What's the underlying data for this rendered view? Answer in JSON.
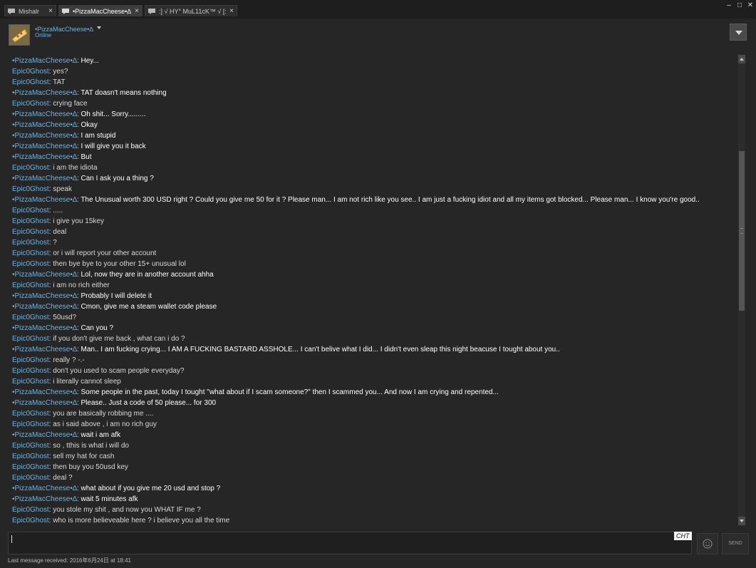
{
  "tabs": [
    {
      "label": "Mishalr",
      "close": "×"
    },
    {
      "label": "•PizzaMacCheese•∆",
      "close": "×"
    },
    {
      "label": ":] √ HY° MuL11cK™ √ [:",
      "close": "×"
    }
  ],
  "window_controls": {
    "minimize": "–",
    "maximize": "□",
    "close": "✕"
  },
  "header": {
    "name": "•PizzaMacCheese•∆",
    "status": "Online"
  },
  "messages": [
    {
      "who": "•PizzaMacCheese•∆",
      "text": "Hey...",
      "them": true
    },
    {
      "who": "Epic0Ghost",
      "text": "yes?",
      "them": false
    },
    {
      "who": "Epic0Ghost",
      "text": "TAT",
      "them": false
    },
    {
      "who": "•PizzaMacCheese•∆",
      "text": "TAT doasn't means nothing",
      "them": true
    },
    {
      "who": "Epic0Ghost",
      "text": "crying face",
      "them": false
    },
    {
      "who": "•PizzaMacCheese•∆",
      "text": "Oh shit... Sorry.........",
      "them": true
    },
    {
      "who": "•PizzaMacCheese•∆",
      "text": "Okay",
      "them": true
    },
    {
      "who": "•PizzaMacCheese•∆",
      "text": "I am stupid",
      "them": true
    },
    {
      "who": "•PizzaMacCheese•∆",
      "text": "I will give you it back",
      "them": true
    },
    {
      "who": "•PizzaMacCheese•∆",
      "text": "But",
      "them": true
    },
    {
      "who": "Epic0Ghost",
      "text": "i am the idiota",
      "them": false
    },
    {
      "who": "•PizzaMacCheese•∆",
      "text": "Can I ask you a thing ?",
      "them": true
    },
    {
      "who": "Epic0Ghost",
      "text": "speak",
      "them": false
    },
    {
      "who": "•PizzaMacCheese•∆",
      "text": "The Unusual worth 300 USD right ? Could you give me 50 for it ? Please man... I am not rich like you see.. I am just a fucking idiot and all my items got blocked... Please man... I know you're good..",
      "them": true
    },
    {
      "who": "Epic0Ghost",
      "text": ".....",
      "them": false
    },
    {
      "who": "Epic0Ghost",
      "text": "i give you 15key",
      "them": false
    },
    {
      "who": "Epic0Ghost",
      "text": "deal",
      "them": false
    },
    {
      "who": "Epic0Ghost",
      "text": "?",
      "them": false
    },
    {
      "who": "Epic0Ghost",
      "text": "or i will report your other account",
      "them": false
    },
    {
      "who": "Epic0Ghost",
      "text": "then bye bye to your other 15+ unusual lol",
      "them": false
    },
    {
      "who": "•PizzaMacCheese•∆",
      "text": "Lol, now they are in another account ahha",
      "them": true
    },
    {
      "who": "Epic0Ghost",
      "text": "i am no rich either",
      "them": false
    },
    {
      "who": "•PizzaMacCheese•∆",
      "text": "Probably I will delete it",
      "them": true
    },
    {
      "who": "•PizzaMacCheese•∆",
      "text": "Cmon, give me a steam wallet code please",
      "them": true
    },
    {
      "who": "Epic0Ghost",
      "text": "50usd?",
      "them": false
    },
    {
      "who": "•PizzaMacCheese•∆",
      "text": "Can you ?",
      "them": true
    },
    {
      "who": "Epic0Ghost",
      "text": "if you don't give me back , what can i do ?",
      "them": false
    },
    {
      "who": "•PizzaMacCheese•∆",
      "text": "Man.. I am fucking crying... I AM A FUCKING BASTARD ASSHOLE... I can't belive what I did... I didn't even sleap this night beacuse I tought about you..",
      "them": true
    },
    {
      "who": "Epic0Ghost",
      "text": "really ? -.-",
      "them": false
    },
    {
      "who": "Epic0Ghost",
      "text": "don't you used to scam people everyday?",
      "them": false
    },
    {
      "who": "Epic0Ghost",
      "text": "i literally cannot sleep",
      "them": false
    },
    {
      "who": "•PizzaMacCheese•∆",
      "text": "Some people in the past, today I tought \"what about if I scam someone?\" then I scammed you... And now I am crying and repented...",
      "them": true
    },
    {
      "who": "•PizzaMacCheese•∆",
      "text": "Please.. Just a code of 50 please... for 300",
      "them": true
    },
    {
      "who": "Epic0Ghost",
      "text": "you are basically robbing me ....",
      "them": false
    },
    {
      "who": "Epic0Ghost",
      "text": "as i said above , i am no rich guy",
      "them": false
    },
    {
      "who": "•PizzaMacCheese•∆",
      "text": "wait i am afk",
      "them": true
    },
    {
      "who": "Epic0Ghost",
      "text": "so , tthis is what i will do",
      "them": false
    },
    {
      "who": "Epic0Ghost",
      "text": "sell my hat for cash",
      "them": false
    },
    {
      "who": "Epic0Ghost",
      "text": "then buy you 50usd key",
      "them": false
    },
    {
      "who": "Epic0Ghost",
      "text": "deal ?",
      "them": false
    },
    {
      "who": "•PizzaMacCheese•∆",
      "text": "what about if you give me 20 usd and stop ?",
      "them": true
    },
    {
      "who": "•PizzaMacCheese•∆",
      "text": "wait 5 minutes afk",
      "them": true
    },
    {
      "who": "Epic0Ghost",
      "text": "you stole my shit , and now you WHAT IF me ?",
      "them": false
    },
    {
      "who": "Epic0Ghost",
      "text": "who is more believeable here ? i believe you all the time",
      "them": false
    }
  ],
  "input": {
    "value": "",
    "tag": "CHT"
  },
  "buttons": {
    "send": "SEND"
  },
  "footer": {
    "last_message": "Last message received: 2016年6月24日 at 18:41"
  },
  "colors": {
    "background": "#262626",
    "name": "#6cb3e0",
    "text": "#d8d8d8"
  }
}
